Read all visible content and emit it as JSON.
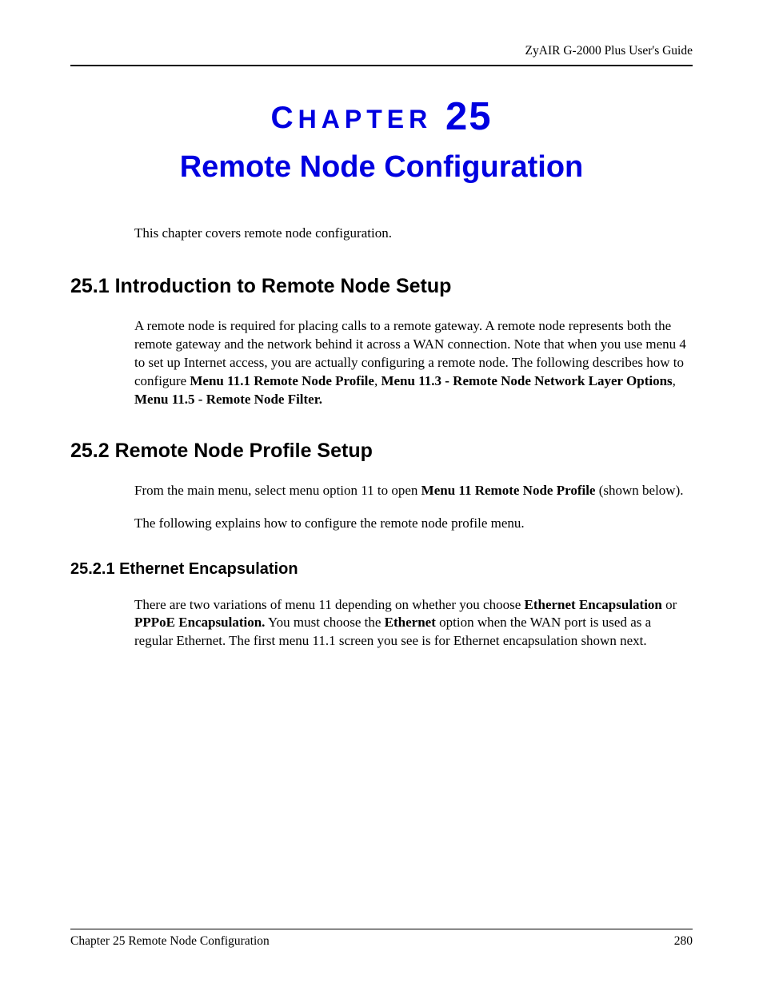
{
  "header": {
    "guide": "ZyAIR G-2000 Plus User's Guide"
  },
  "chapter": {
    "label_letter": "C",
    "label_rest": "HAPTER",
    "number": "25",
    "title": "Remote Node Configuration"
  },
  "intro": "This chapter covers remote node configuration.",
  "sections": {
    "s1": {
      "heading": "25.1  Introduction to Remote Node Setup",
      "p1_a": "A remote node is required for placing calls to a remote gateway. A remote node represents both the remote gateway and the network behind it across a WAN connection. Note that when you use menu 4 to set up Internet access, you are actually configuring a remote node. The following describes how to configure ",
      "p1_b": "Menu 11.1 Remote Node Profile",
      "p1_c": ", ",
      "p1_d": "Menu 11.3 - Remote Node Network Layer Options",
      "p1_e": ", ",
      "p1_f": "Menu 11.5 - Remote Node Filter."
    },
    "s2": {
      "heading": "25.2  Remote Node Profile Setup",
      "p1_a": "From the main menu, select menu option 11 to open ",
      "p1_b": "Menu 11 Remote Node Profile",
      "p1_c": " (shown below).",
      "p2": "The following explains how to configure the remote node profile menu."
    },
    "s21": {
      "heading": "25.2.1  Ethernet Encapsulation",
      "p1_a": "There are two variations of menu 11 depending on whether you choose ",
      "p1_b": "Ethernet Encapsulation",
      "p1_c": " or ",
      "p1_d": "PPPoE Encapsulation.",
      "p1_e": " You must choose the ",
      "p1_f": "Ethernet",
      "p1_g": " option when the WAN port is used as a regular Ethernet. The first menu 11.1 screen you see is for Ethernet encapsulation shown next."
    }
  },
  "footer": {
    "left": "Chapter 25 Remote Node Configuration",
    "right": "280"
  }
}
